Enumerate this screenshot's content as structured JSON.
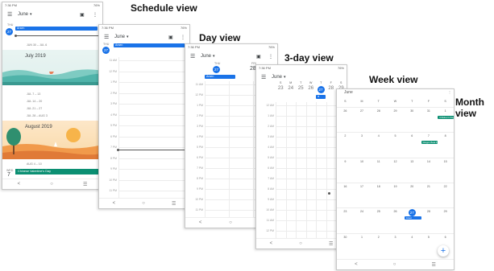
{
  "status_bar": {
    "time": "7:36 PM",
    "battery": "76%"
  },
  "month_selector": "June",
  "labels": {
    "schedule": "Schedule view",
    "day": "Day view",
    "three_day": "3-day view",
    "week": "Week view",
    "month": "Month view"
  },
  "icons": {
    "menu": "menu-icon",
    "calendar": "calendar-icon",
    "more": "more-vert-icon",
    "add": "add-fab-icon"
  },
  "nav": {
    "back": "<",
    "home": "○",
    "recents": "☰"
  },
  "schedule": {
    "today_dow": "THU",
    "today_num": "27",
    "event": "Arsen",
    "week_range": "JUN 30 – JUL 6",
    "july_banner": "July 2019",
    "weeks": [
      "JUL 7 – 13",
      "JUL 14 – 20",
      "JUL 21 – 27",
      "JUL 28 – AUG 3"
    ],
    "aug_banner": "August 2019",
    "aug_week": "AUG 4 – 10",
    "aug_dow": "WED",
    "aug_num": "7",
    "aug_event": "Chinese Valentine's Day"
  },
  "day": {
    "today_dow": "THU",
    "today_num": "27",
    "event": "Arsen",
    "hours": [
      "11 AM",
      "12 PM",
      "1 PM",
      "2 PM",
      "3 PM",
      "4 PM",
      "5 PM",
      "6 PM",
      "7 PM",
      "8 PM",
      "9 PM",
      "10 PM",
      "11 PM"
    ]
  },
  "three_day": {
    "days": [
      {
        "dow": "THU",
        "num": "27",
        "today": true
      },
      {
        "dow": "FRI",
        "num": "28",
        "today": false
      }
    ],
    "event": "Arsen",
    "hours": [
      "11 AM",
      "12 PM",
      "1 PM",
      "2 PM",
      "3 PM",
      "4 PM",
      "5 PM",
      "6 PM",
      "7 PM",
      "8 PM",
      "9 PM",
      "10 PM",
      "11 PM"
    ]
  },
  "week": {
    "days": [
      {
        "dow": "S",
        "num": "23",
        "today": false
      },
      {
        "dow": "M",
        "num": "24",
        "today": false
      },
      {
        "dow": "T",
        "num": "25",
        "today": false
      },
      {
        "dow": "W",
        "num": "26",
        "today": false
      },
      {
        "dow": "T",
        "num": "27",
        "today": true
      },
      {
        "dow": "F",
        "num": "28",
        "today": false
      },
      {
        "dow": "S",
        "num": "29",
        "today": false
      }
    ],
    "hours": [
      "12 AM",
      "1 AM",
      "2 AM",
      "3 AM",
      "4 AM",
      "5 AM",
      "6 AM",
      "7 AM",
      "8 AM",
      "9 AM",
      "10 AM",
      "11 AM",
      "12 PM"
    ]
  },
  "month": {
    "title": "June",
    "dows": [
      "S",
      "M",
      "T",
      "W",
      "T",
      "F",
      "S"
    ],
    "weeks": [
      [
        "26",
        "27",
        "28",
        "29",
        "30",
        "31",
        "1"
      ],
      [
        "2",
        "3",
        "4",
        "5",
        "6",
        "7",
        "8"
      ],
      [
        "9",
        "10",
        "11",
        "12",
        "13",
        "14",
        "15"
      ],
      [
        "16",
        "17",
        "18",
        "19",
        "20",
        "21",
        "22"
      ],
      [
        "23",
        "24",
        "25",
        "26",
        "27",
        "28",
        "29"
      ],
      [
        "30",
        "1",
        "2",
        "3",
        "4",
        "5",
        "6"
      ]
    ],
    "events": [
      {
        "week": 0,
        "day": 6,
        "label": "Children's Day"
      },
      {
        "week": 1,
        "day": 5,
        "label": "Dragon Boat Fe"
      },
      {
        "week": 4,
        "day": 4,
        "label": "Arsen"
      }
    ]
  }
}
